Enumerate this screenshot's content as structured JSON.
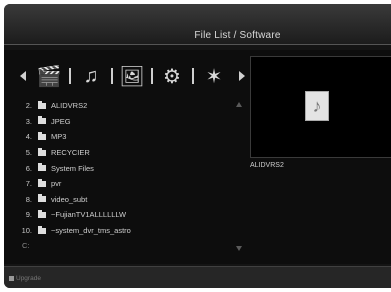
{
  "window": {
    "title": "File List / Software"
  },
  "toolbar": {
    "categories": [
      {
        "icon": "movie-clapper-icon"
      },
      {
        "icon": "music-note-icon"
      },
      {
        "icon": "photo-gallery-icon"
      },
      {
        "icon": "settings-gear-icon"
      },
      {
        "icon": "software-sparkle-icon"
      }
    ]
  },
  "file_list": {
    "items": [
      {
        "num": "2.",
        "name": "ALIDVRS2"
      },
      {
        "num": "3.",
        "name": "JPEG"
      },
      {
        "num": "4.",
        "name": "MP3"
      },
      {
        "num": "5.",
        "name": "RECYCIER"
      },
      {
        "num": "6.",
        "name": "System Files"
      },
      {
        "num": "7.",
        "name": "pvr"
      },
      {
        "num": "8.",
        "name": "video_subt"
      },
      {
        "num": "9.",
        "name": "~FujianTV1ALLLLLLW"
      },
      {
        "num": "10.",
        "name": "~system_dvr_tms_astro"
      }
    ],
    "current_path": "C:"
  },
  "preview": {
    "selected_name": "ALIDVRS2"
  },
  "footer": {
    "upgrade_label": "Upgrade"
  }
}
